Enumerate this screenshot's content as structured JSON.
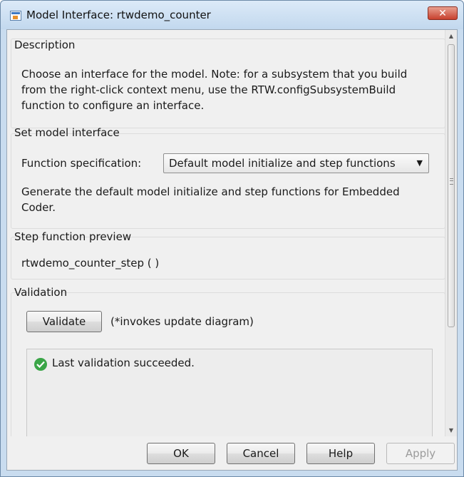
{
  "window": {
    "title": "Model Interface: rtwdemo_counter",
    "close_glyph": "✕"
  },
  "description": {
    "title": "Description",
    "lines": [
      "Choose an interface for the model. Note: for a subsystem that you build",
      "from the right-click context menu, use the RTW.configSubsystemBuild",
      "function to configure an interface."
    ]
  },
  "interface": {
    "title": "Set model interface",
    "function_spec_label": "Function specification:",
    "function_spec_value": "Default model initialize and step functions",
    "help_lines": [
      "Generate the default model initialize and step functions for Embedded",
      "Coder."
    ]
  },
  "preview": {
    "title": "Step function preview",
    "signature": "rtwdemo_counter_step ( )"
  },
  "validation": {
    "title": "Validation",
    "validate_label": "Validate",
    "note": "(*invokes update diagram)",
    "status_icon": "check-circle-icon",
    "status_text": "Last validation succeeded.",
    "status_color": "#3aa547"
  },
  "buttons": {
    "ok": "OK",
    "cancel": "Cancel",
    "help": "Help",
    "apply": "Apply"
  }
}
